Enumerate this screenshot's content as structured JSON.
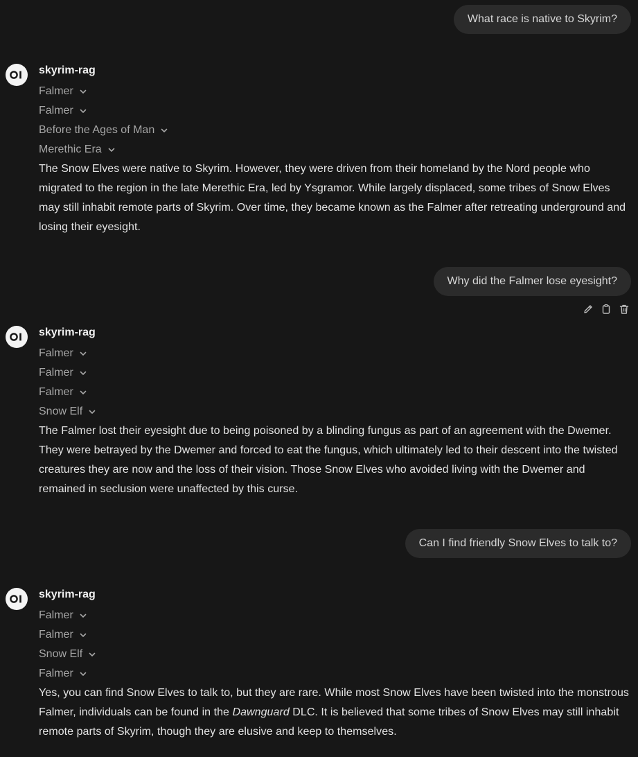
{
  "conversation": [
    {
      "user": "What race is native to Skyrim?",
      "model": "skyrim-rag",
      "sources": [
        "Falmer",
        "Falmer",
        "Before the Ages of Man",
        "Merethic Era"
      ],
      "answer": "The Snow Elves were native to Skyrim. However, they were driven from their homeland by the Nord people who migrated to the region in the late Merethic Era, led by Ysgramor. While largely displaced, some tribes of Snow Elves may still inhabit remote parts of Skyrim. Over time, they became known as the Falmer after retreating underground and losing their eyesight."
    },
    {
      "user": "Why did the Falmer lose eyesight?",
      "model": "skyrim-rag",
      "sources": [
        "Falmer",
        "Falmer",
        "Falmer",
        "Snow Elf"
      ],
      "answer": "The Falmer lost their eyesight due to being poisoned by a blinding fungus as part of an agreement with the Dwemer. They were betrayed by the Dwemer and forced to eat the fungus, which ultimately led to their descent into the twisted creatures they are now and the loss of their vision. Those Snow Elves who avoided living with the Dwemer and remained in seclusion were unaffected by this curse."
    },
    {
      "user": "Can I find friendly Snow Elves to talk to?",
      "model": "skyrim-rag",
      "sources": [
        "Falmer",
        "Falmer",
        "Snow Elf",
        "Falmer"
      ],
      "answer_before": "Yes, you can find Snow Elves to talk to, but they are rare. While most Snow Elves have been twisted into the monstrous Falmer, individuals can be found in the ",
      "answer_em": "Dawnguard",
      "answer_after": " DLC. It is believed that some tribes of Snow Elves may still inhabit remote parts of Skyrim, though they are elusive and keep to themselves."
    }
  ],
  "icons": {
    "avatar": "openwebui-logo-icon",
    "chevron": "chevron-down-icon",
    "edit": "pencil-icon",
    "copy": "clipboard-icon",
    "delete": "trash-icon"
  },
  "colors": {
    "background": "#171717",
    "user_bubble": "#2b2b2b",
    "text": "#e3e3e3",
    "muted": "#a6a6a6"
  }
}
